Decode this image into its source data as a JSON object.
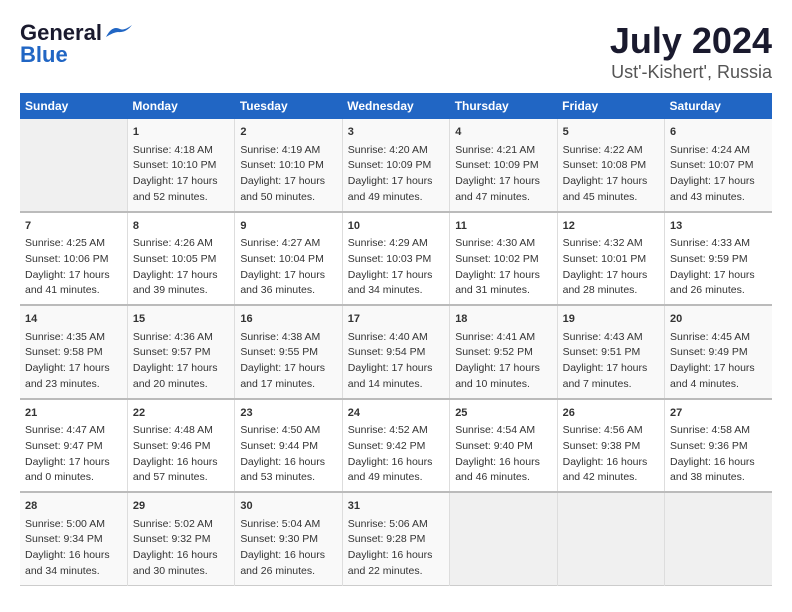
{
  "header": {
    "logo_general": "General",
    "logo_blue": "Blue",
    "title": "July 2024",
    "subtitle": "Ust'-Kishert', Russia"
  },
  "days_of_week": [
    "Sunday",
    "Monday",
    "Tuesday",
    "Wednesday",
    "Thursday",
    "Friday",
    "Saturday"
  ],
  "weeks": [
    [
      {
        "day": "",
        "content": ""
      },
      {
        "day": "1",
        "content": "Sunrise: 4:18 AM\nSunset: 10:10 PM\nDaylight: 17 hours\nand 52 minutes."
      },
      {
        "day": "2",
        "content": "Sunrise: 4:19 AM\nSunset: 10:10 PM\nDaylight: 17 hours\nand 50 minutes."
      },
      {
        "day": "3",
        "content": "Sunrise: 4:20 AM\nSunset: 10:09 PM\nDaylight: 17 hours\nand 49 minutes."
      },
      {
        "day": "4",
        "content": "Sunrise: 4:21 AM\nSunset: 10:09 PM\nDaylight: 17 hours\nand 47 minutes."
      },
      {
        "day": "5",
        "content": "Sunrise: 4:22 AM\nSunset: 10:08 PM\nDaylight: 17 hours\nand 45 minutes."
      },
      {
        "day": "6",
        "content": "Sunrise: 4:24 AM\nSunset: 10:07 PM\nDaylight: 17 hours\nand 43 minutes."
      }
    ],
    [
      {
        "day": "7",
        "content": "Sunrise: 4:25 AM\nSunset: 10:06 PM\nDaylight: 17 hours\nand 41 minutes."
      },
      {
        "day": "8",
        "content": "Sunrise: 4:26 AM\nSunset: 10:05 PM\nDaylight: 17 hours\nand 39 minutes."
      },
      {
        "day": "9",
        "content": "Sunrise: 4:27 AM\nSunset: 10:04 PM\nDaylight: 17 hours\nand 36 minutes."
      },
      {
        "day": "10",
        "content": "Sunrise: 4:29 AM\nSunset: 10:03 PM\nDaylight: 17 hours\nand 34 minutes."
      },
      {
        "day": "11",
        "content": "Sunrise: 4:30 AM\nSunset: 10:02 PM\nDaylight: 17 hours\nand 31 minutes."
      },
      {
        "day": "12",
        "content": "Sunrise: 4:32 AM\nSunset: 10:01 PM\nDaylight: 17 hours\nand 28 minutes."
      },
      {
        "day": "13",
        "content": "Sunrise: 4:33 AM\nSunset: 9:59 PM\nDaylight: 17 hours\nand 26 minutes."
      }
    ],
    [
      {
        "day": "14",
        "content": "Sunrise: 4:35 AM\nSunset: 9:58 PM\nDaylight: 17 hours\nand 23 minutes."
      },
      {
        "day": "15",
        "content": "Sunrise: 4:36 AM\nSunset: 9:57 PM\nDaylight: 17 hours\nand 20 minutes."
      },
      {
        "day": "16",
        "content": "Sunrise: 4:38 AM\nSunset: 9:55 PM\nDaylight: 17 hours\nand 17 minutes."
      },
      {
        "day": "17",
        "content": "Sunrise: 4:40 AM\nSunset: 9:54 PM\nDaylight: 17 hours\nand 14 minutes."
      },
      {
        "day": "18",
        "content": "Sunrise: 4:41 AM\nSunset: 9:52 PM\nDaylight: 17 hours\nand 10 minutes."
      },
      {
        "day": "19",
        "content": "Sunrise: 4:43 AM\nSunset: 9:51 PM\nDaylight: 17 hours\nand 7 minutes."
      },
      {
        "day": "20",
        "content": "Sunrise: 4:45 AM\nSunset: 9:49 PM\nDaylight: 17 hours\nand 4 minutes."
      }
    ],
    [
      {
        "day": "21",
        "content": "Sunrise: 4:47 AM\nSunset: 9:47 PM\nDaylight: 17 hours\nand 0 minutes."
      },
      {
        "day": "22",
        "content": "Sunrise: 4:48 AM\nSunset: 9:46 PM\nDaylight: 16 hours\nand 57 minutes."
      },
      {
        "day": "23",
        "content": "Sunrise: 4:50 AM\nSunset: 9:44 PM\nDaylight: 16 hours\nand 53 minutes."
      },
      {
        "day": "24",
        "content": "Sunrise: 4:52 AM\nSunset: 9:42 PM\nDaylight: 16 hours\nand 49 minutes."
      },
      {
        "day": "25",
        "content": "Sunrise: 4:54 AM\nSunset: 9:40 PM\nDaylight: 16 hours\nand 46 minutes."
      },
      {
        "day": "26",
        "content": "Sunrise: 4:56 AM\nSunset: 9:38 PM\nDaylight: 16 hours\nand 42 minutes."
      },
      {
        "day": "27",
        "content": "Sunrise: 4:58 AM\nSunset: 9:36 PM\nDaylight: 16 hours\nand 38 minutes."
      }
    ],
    [
      {
        "day": "28",
        "content": "Sunrise: 5:00 AM\nSunset: 9:34 PM\nDaylight: 16 hours\nand 34 minutes."
      },
      {
        "day": "29",
        "content": "Sunrise: 5:02 AM\nSunset: 9:32 PM\nDaylight: 16 hours\nand 30 minutes."
      },
      {
        "day": "30",
        "content": "Sunrise: 5:04 AM\nSunset: 9:30 PM\nDaylight: 16 hours\nand 26 minutes."
      },
      {
        "day": "31",
        "content": "Sunrise: 5:06 AM\nSunset: 9:28 PM\nDaylight: 16 hours\nand 22 minutes."
      },
      {
        "day": "",
        "content": ""
      },
      {
        "day": "",
        "content": ""
      },
      {
        "day": "",
        "content": ""
      }
    ]
  ]
}
